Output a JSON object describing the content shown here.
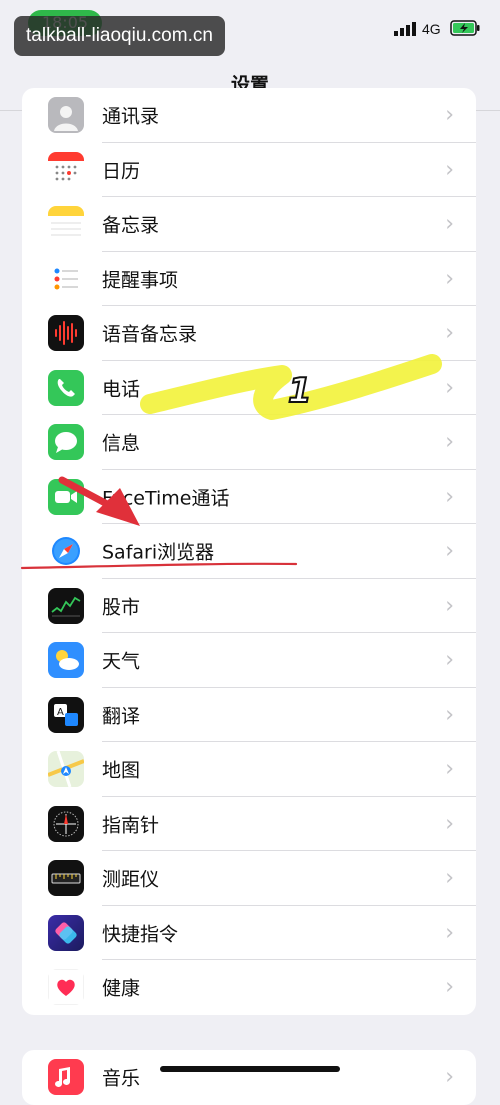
{
  "status": {
    "time": "18:05",
    "network": "4G"
  },
  "watermark": "talkball-liaoqiu.com.cn",
  "nav": {
    "title": "设置"
  },
  "group1": [
    {
      "label": "通讯录",
      "icon": "contacts-icon"
    },
    {
      "label": "日历",
      "icon": "calendar-icon"
    },
    {
      "label": "备忘录",
      "icon": "notes-icon"
    },
    {
      "label": "提醒事项",
      "icon": "reminders-icon"
    },
    {
      "label": "语音备忘录",
      "icon": "voice-memos-icon"
    },
    {
      "label": "电话",
      "icon": "phone-icon"
    },
    {
      "label": "信息",
      "icon": "messages-icon"
    },
    {
      "label": "FaceTime通话",
      "icon": "facetime-icon"
    },
    {
      "label": "Safari浏览器",
      "icon": "safari-icon"
    },
    {
      "label": "股市",
      "icon": "stocks-icon"
    },
    {
      "label": "天气",
      "icon": "weather-icon"
    },
    {
      "label": "翻译",
      "icon": "translate-icon"
    },
    {
      "label": "地图",
      "icon": "maps-icon"
    },
    {
      "label": "指南针",
      "icon": "compass-icon"
    },
    {
      "label": "测距仪",
      "icon": "measure-icon"
    },
    {
      "label": "快捷指令",
      "icon": "shortcuts-icon"
    },
    {
      "label": "健康",
      "icon": "health-icon"
    }
  ],
  "group2": [
    {
      "label": "音乐",
      "icon": "music-icon"
    }
  ],
  "annotation": {
    "step_number": "1"
  },
  "colors": {
    "highlight": "#f2f23a",
    "arrow": "#e0303a",
    "underline": "#d8323a",
    "accent_green": "#34c759"
  }
}
